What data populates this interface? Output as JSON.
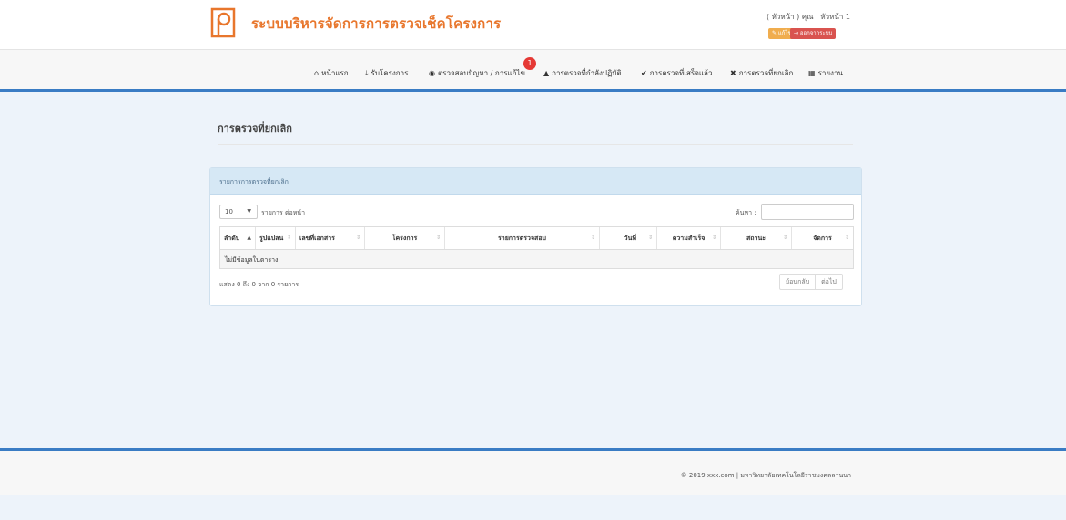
{
  "header": {
    "brand": "ระบบบริหารจัดการการตรวจเช็คโครงการ",
    "user_line": "( หัวหน้า ) คุณ : หัวหน้า 1",
    "edit_profile": "✎ แก้ไขข้อมูลส่วนตัว",
    "logout": "⇥ ออกจากระบบ",
    "brand_color": "#e8762c"
  },
  "nav": {
    "home": "หน้าแรก",
    "receive": "รับโครงการ",
    "inspect": "ตรวจสอบปัญหา / การแก้ไข",
    "inspect_badge": "1",
    "in_progress": "การตรวจที่กำลังปฏิบัติ",
    "done": "การตรวจที่เสร็จแล้ว",
    "cancelled": "การตรวจที่ยกเลิก",
    "report": "รายงาน"
  },
  "page": {
    "title": "การตรวจที่ยกเลิก"
  },
  "panel": {
    "heading": "รายการการตรวจที่ยกเลิก",
    "length_value": "10",
    "length_label": "รายการ ต่อหน้า",
    "search_label": "ค้นหา :",
    "columns": [
      "ลำดับ",
      "รูปแปลน",
      "เลขที่เอกสาร",
      "โครงการ",
      "รายการตรวจสอบ",
      "วันที่",
      "ความสำเร็จ",
      "สถานะ",
      "จัดการ"
    ],
    "empty": "ไม่มีข้อมูลในตาราง",
    "info": "แสดง 0 ถึง 0 จาก 0 รายการ",
    "prev": "ย้อนกลับ",
    "next": "ต่อไป"
  },
  "footer": {
    "copyright": "© 2019 xxx.com | มหาวิทยาลัยเทคโนโลยีราชมงคลลานนา"
  }
}
